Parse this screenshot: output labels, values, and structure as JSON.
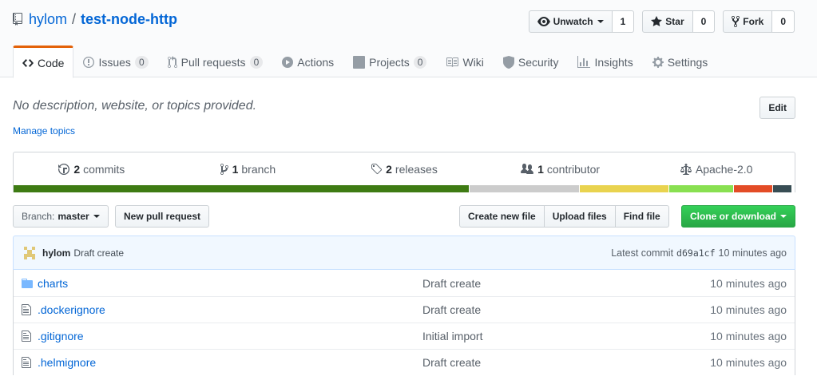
{
  "repo": {
    "owner": "hylom",
    "separator": "/",
    "name": "test-node-http"
  },
  "actions": {
    "watch": {
      "label": "Unwatch",
      "count": "1"
    },
    "star": {
      "label": "Star",
      "count": "0"
    },
    "fork": {
      "label": "Fork",
      "count": "0"
    }
  },
  "tabs": [
    {
      "label": "Code",
      "counter": null,
      "icon": "code-icon",
      "selected": true
    },
    {
      "label": "Issues",
      "counter": "0",
      "icon": "issue-icon"
    },
    {
      "label": "Pull requests",
      "counter": "0",
      "icon": "pull-request-icon"
    },
    {
      "label": "Actions",
      "counter": null,
      "icon": "play-icon"
    },
    {
      "label": "Projects",
      "counter": "0",
      "icon": "project-icon"
    },
    {
      "label": "Wiki",
      "counter": null,
      "icon": "book-icon"
    },
    {
      "label": "Security",
      "counter": null,
      "icon": "shield-icon"
    },
    {
      "label": "Insights",
      "counter": null,
      "icon": "graph-icon"
    },
    {
      "label": "Settings",
      "counter": null,
      "icon": "gear-icon"
    }
  ],
  "description": "No description, website, or topics provided.",
  "manage_topics": "Manage topics",
  "edit_label": "Edit",
  "summary": {
    "commits": {
      "num": "2",
      "label": "commits"
    },
    "branch": {
      "num": "1",
      "label": "branch"
    },
    "releases": {
      "num": "2",
      "label": "releases"
    },
    "contributor": {
      "num": "1",
      "label": "contributor"
    },
    "license": "Apache-2.0"
  },
  "language_colors": [
    "#3e7b13",
    "#cccccc",
    "#e9d34f",
    "#89e051",
    "#e34c26",
    "#384d54"
  ],
  "language_shares": [
    0.584,
    0.141,
    0.114,
    0.083,
    0.05,
    0.025
  ],
  "branch_select": {
    "prefix": "Branch:",
    "value": "master"
  },
  "new_pr": "New pull request",
  "file_actions": [
    "Create new file",
    "Upload files",
    "Find file"
  ],
  "clone": "Clone or download",
  "commit": {
    "author": "hylom",
    "message": "Draft create",
    "latest_label": "Latest commit",
    "sha": "d69a1cf",
    "age": "10 minutes ago"
  },
  "files": [
    {
      "type": "folder",
      "name": "charts",
      "message": "Draft create",
      "age": "10 minutes ago"
    },
    {
      "type": "file",
      "name": ".dockerignore",
      "message": "Draft create",
      "age": "10 minutes ago"
    },
    {
      "type": "file",
      "name": ".gitignore",
      "message": "Initial import",
      "age": "10 minutes ago"
    },
    {
      "type": "file",
      "name": ".helmignore",
      "message": "Draft create",
      "age": "10 minutes ago"
    }
  ]
}
